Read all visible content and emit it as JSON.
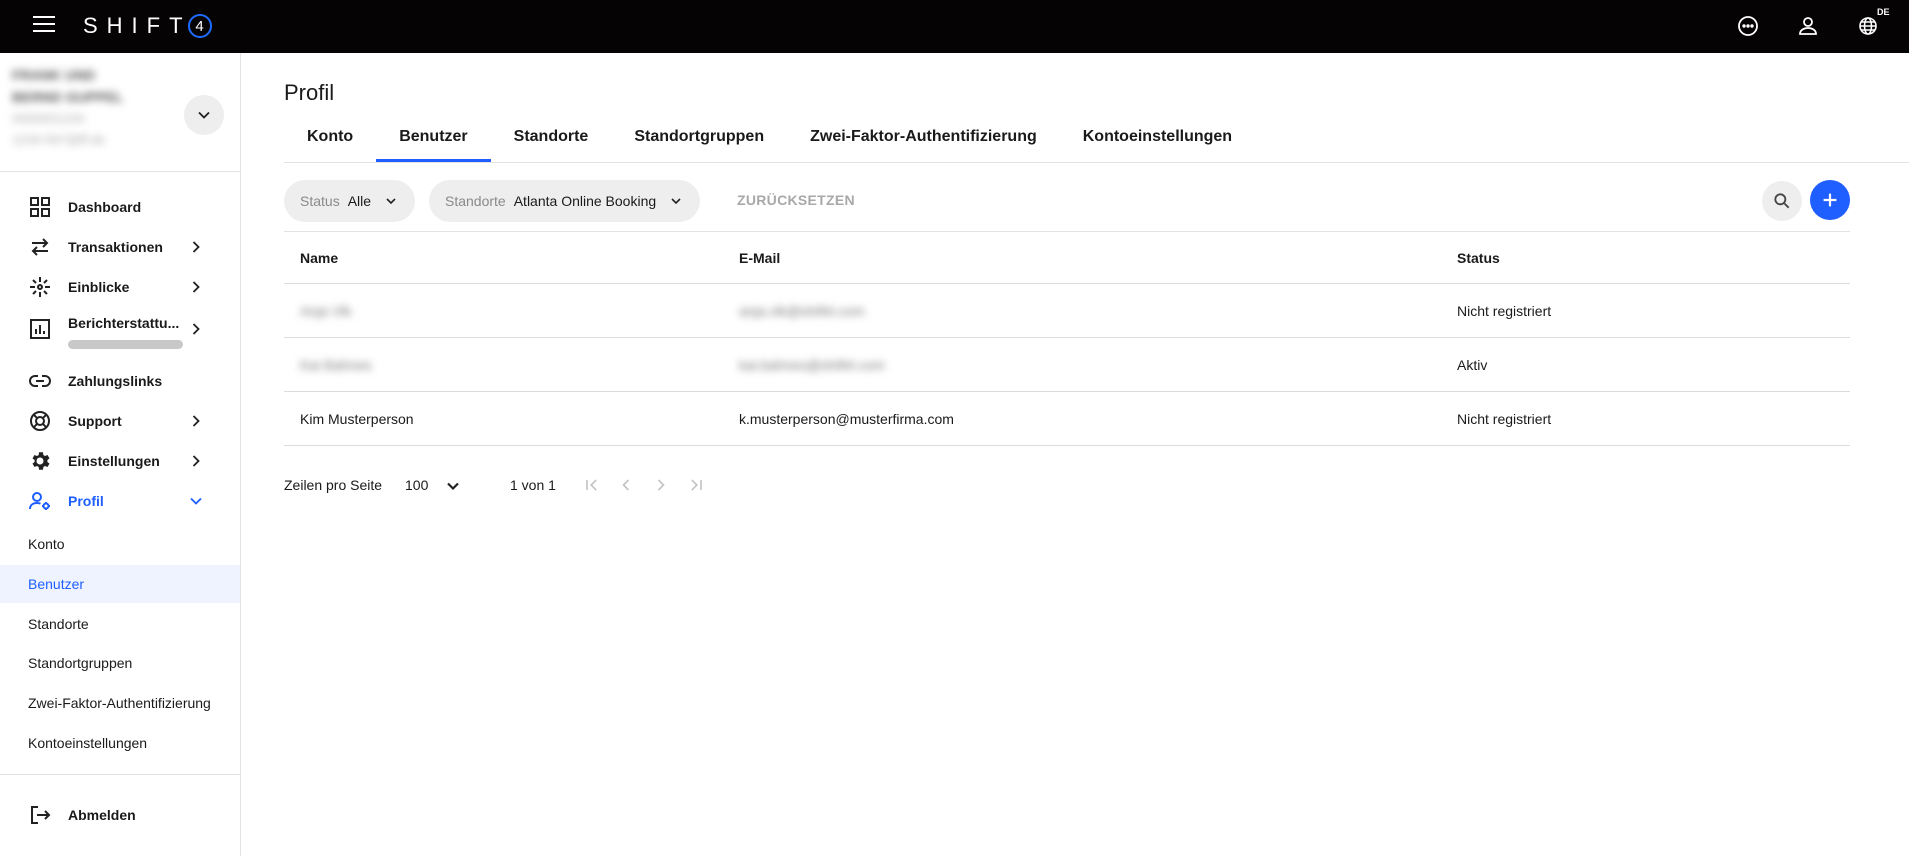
{
  "app": {
    "logo_text": "SHIFT",
    "logo_badge": "4",
    "lang_badge": "DE"
  },
  "account": {
    "line1": "FRANK UND",
    "line2": "BERND GUPPEL",
    "line3": "0000001234",
    "line4": "1234-567@ff.de"
  },
  "nav": {
    "dashboard": "Dashboard",
    "transaktionen": "Transaktionen",
    "einblicke": "Einblicke",
    "berichterstattung": "Berichterstattu...",
    "zahlungslinks": "Zahlungslinks",
    "support": "Support",
    "einstellungen": "Einstellungen",
    "profil": "Profil",
    "abmelden": "Abmelden"
  },
  "profile_sub": [
    "Konto",
    "Benutzer",
    "Standorte",
    "Standortgruppen",
    "Zwei-Faktor-Authentifizierung",
    "Kontoeinstellungen"
  ],
  "page": {
    "title": "Profil"
  },
  "tabs": [
    "Konto",
    "Benutzer",
    "Standorte",
    "Standortgruppen",
    "Zwei-Faktor-Authentifizierung",
    "Kontoeinstellungen"
  ],
  "filters": {
    "status_label": "Status",
    "status_value": "Alle",
    "standorte_label": "Standorte",
    "standorte_value": "Atlanta Online Booking",
    "reset_label": "ZURÜCKSETZEN"
  },
  "table": {
    "headers": [
      "Name",
      "E-Mail",
      "Status"
    ],
    "rows": [
      {
        "name": "Anja Vlk",
        "email": "anja.vlk@shift4.com",
        "status": "Nicht registriert"
      },
      {
        "name": "Kai Bahnes",
        "email": "kai.bahnes@shift4.com",
        "status": "Aktiv"
      },
      {
        "name": "Kim Musterperson",
        "email": "k.musterperson@musterfirma.com",
        "status": "Nicht registriert"
      }
    ]
  },
  "pagination": {
    "rows_per_page_label": "Zeilen pro Seite",
    "rows_per_page_value": "100",
    "range": "1 von 1"
  },
  "colors": {
    "topbar": "#060304",
    "accent": "#1f5eff",
    "chip_bg": "#eeeeee",
    "active_sub_bg": "#eef3ff"
  }
}
